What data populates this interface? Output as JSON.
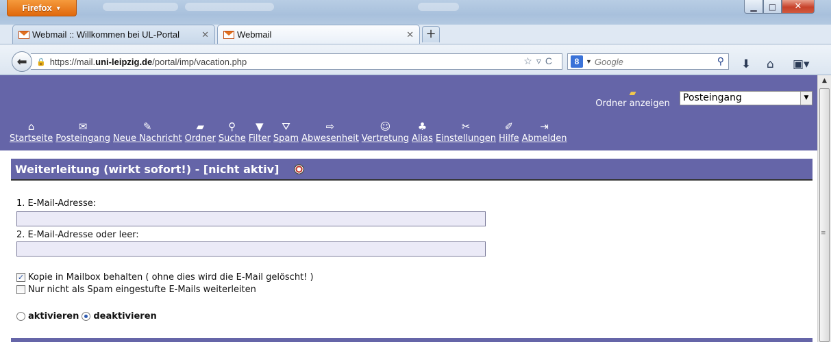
{
  "browser": {
    "firefox_button": "Firefox",
    "tabs": [
      {
        "label": "Webmail :: Willkommen bei UL-Portal"
      },
      {
        "label": "Webmail"
      }
    ],
    "url_prefix": "https://mail.",
    "url_domain": "uni-leipzig.de",
    "url_path": "/portal/imp/vacation.php",
    "search_placeholder": "Google"
  },
  "header": {
    "folder_link": "Ordner anzeigen",
    "folder_select": "Posteingang"
  },
  "menu": [
    {
      "label": "Startseite",
      "icon": "home-icon"
    },
    {
      "label": "Posteingang",
      "icon": "inbox-icon"
    },
    {
      "label": "Neue Nachricht",
      "icon": "compose-icon"
    },
    {
      "label": "Ordner",
      "icon": "folder-icon"
    },
    {
      "label": "Suche",
      "icon": "search-icon"
    },
    {
      "label": "Filter",
      "icon": "filter-icon"
    },
    {
      "label": "Spam",
      "icon": "spam-icon"
    },
    {
      "label": "Abwesenheit",
      "icon": "arrow-icon"
    },
    {
      "label": "Vertretung",
      "icon": "people-icon"
    },
    {
      "label": "Alias",
      "icon": "alias-icon"
    },
    {
      "label": "Einstellungen",
      "icon": "tools-icon"
    },
    {
      "label": "Hilfe",
      "icon": "book-icon"
    },
    {
      "label": "Abmelden",
      "icon": "logout-icon"
    }
  ],
  "section": {
    "title": "Weiterleitung (wirkt sofort!) - [nicht aktiv]"
  },
  "form": {
    "email1_label": "1. E-Mail-Adresse:",
    "email1_value": "",
    "email2_label": "2. E-Mail-Adresse oder leer:",
    "email2_value": "",
    "keep_copy_label": "Kopie in Mailbox behalten ( ohne dies wird die E-Mail gelöscht! )",
    "keep_copy_checked": true,
    "no_spam_label": "Nur nicht als Spam eingestufte E-Mails weiterleiten",
    "no_spam_checked": false,
    "activate_label": "aktivieren",
    "deactivate_label": "deaktivieren",
    "selected": "deaktivieren"
  }
}
